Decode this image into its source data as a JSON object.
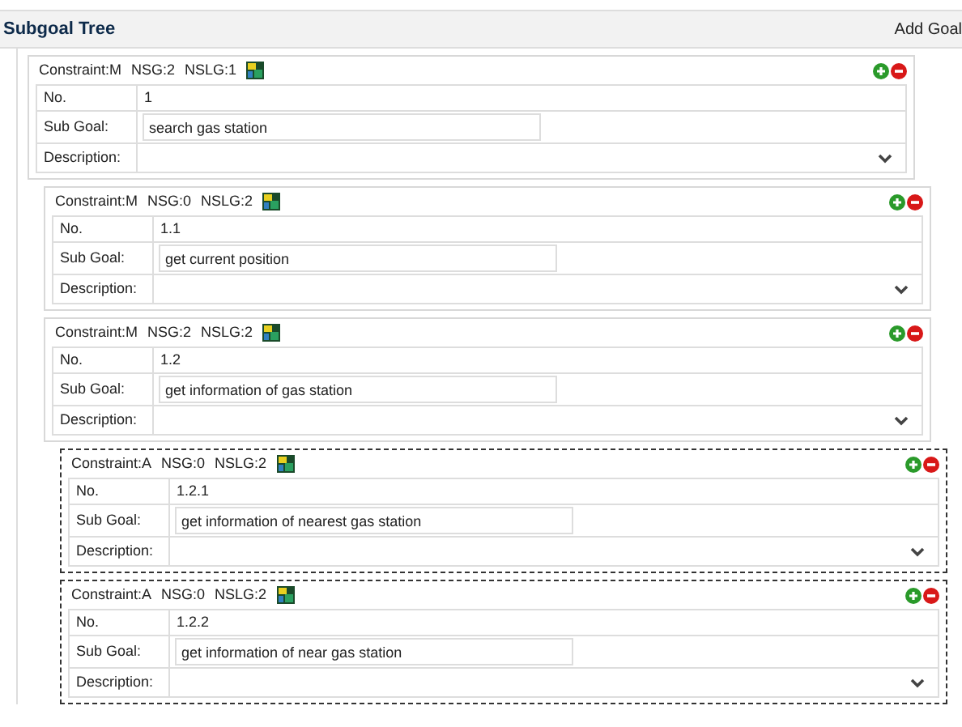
{
  "panel": {
    "title": "Subgoal Tree",
    "action": "Add Goal"
  },
  "goals": [
    {
      "constraint": "Constraint:M",
      "nsg": "NSG:2",
      "nslg": "NSLG:1",
      "selected": false,
      "number_label": "No.",
      "number": "1",
      "subgoal_label": "Sub Goal:",
      "subgoal": "search gas station",
      "description_label": "Description:",
      "children": [
        {
          "constraint": "Constraint:M",
          "nsg": "NSG:0",
          "nslg": "NSLG:2",
          "selected": false,
          "number_label": "No.",
          "number": "1.1",
          "subgoal_label": "Sub Goal:",
          "subgoal": "get current position",
          "description_label": "Description:"
        },
        {
          "constraint": "Constraint:M",
          "nsg": "NSG:2",
          "nslg": "NSLG:2",
          "selected": false,
          "number_label": "No.",
          "number": "1.2",
          "subgoal_label": "Sub Goal:",
          "subgoal": "get information of gas station",
          "description_label": "Description:",
          "children": [
            {
              "constraint": "Constraint:A",
              "nsg": "NSG:0",
              "nslg": "NSLG:2",
              "selected": true,
              "number_label": "No.",
              "number": "1.2.1",
              "subgoal_label": "Sub Goal:",
              "subgoal": "get information of nearest gas station",
              "description_label": "Description:"
            },
            {
              "constraint": "Constraint:A",
              "nsg": "NSG:0",
              "nslg": "NSLG:2",
              "selected": true,
              "number_label": "No.",
              "number": "1.2.2",
              "subgoal_label": "Sub Goal:",
              "subgoal": "get information of near gas station",
              "description_label": "Description:"
            }
          ]
        }
      ]
    }
  ]
}
